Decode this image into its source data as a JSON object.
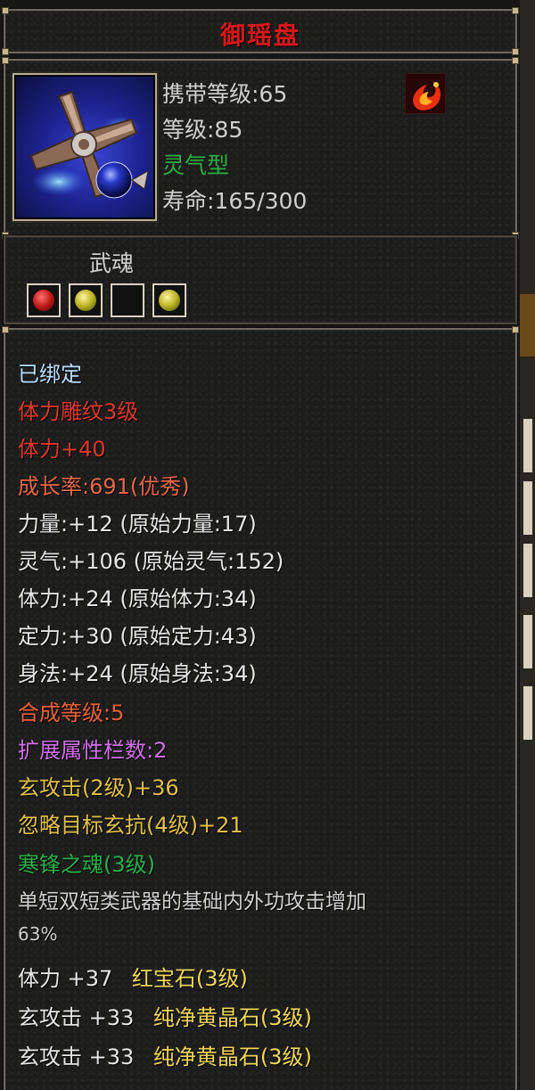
{
  "colors": {
    "title": "#d8181a",
    "bound": "#b7dfff",
    "red": "#e0382a",
    "salmon": "#e86848",
    "white": "#e6e6e6",
    "orange": "#e8603a",
    "purple": "#d070e8",
    "gold": "#e0c048",
    "green": "#28b048",
    "yellow": "#f0d858",
    "grey": "#cfcfcf"
  },
  "item": {
    "name": "御瑶盘",
    "icon": "weapon-shuriken-icon",
    "carry_level": "携带等级:65",
    "level": "等级:85",
    "type": "灵气型",
    "durability": "寿命:165/300",
    "element_icon": "fire-swirl-icon"
  },
  "soul": {
    "label": "武魂",
    "sockets": [
      "red-gem",
      "yellow-gem",
      "empty",
      "yellow-gem"
    ]
  },
  "stats": {
    "bound": "已绑定",
    "engrave": "体力雕纹3级",
    "engrave_bonus": "体力+40",
    "growth": "成长率:691(优秀)",
    "attr_str": "力量:+12  (原始力量:17)",
    "attr_spirit": "灵气:+106  (原始灵气:152)",
    "attr_vit": "体力:+24  (原始体力:34)",
    "attr_def": "定力:+30  (原始定力:43)",
    "attr_agi": "身法:+24  (原始身法:34)",
    "synth_level": "合成等级:5",
    "ext_slots": "扩展属性栏数:2",
    "ext_1": "玄攻击(2级)+36",
    "ext_2": "忽略目标玄抗(4级)+21",
    "soul_skill": "寒锋之魂(3级)",
    "soul_desc_1": "单短双短类武器的基础内外功攻击增加",
    "soul_desc_2": "63%",
    "gem_1_stat": "体力 +37",
    "gem_1_name": "红宝石(3级)",
    "gem_2_stat": "玄攻击 +33",
    "gem_2_name": "纯净黄晶石(3级)",
    "gem_3_stat": "玄攻击 +33",
    "gem_3_name": "纯净黄晶石(3级)"
  }
}
